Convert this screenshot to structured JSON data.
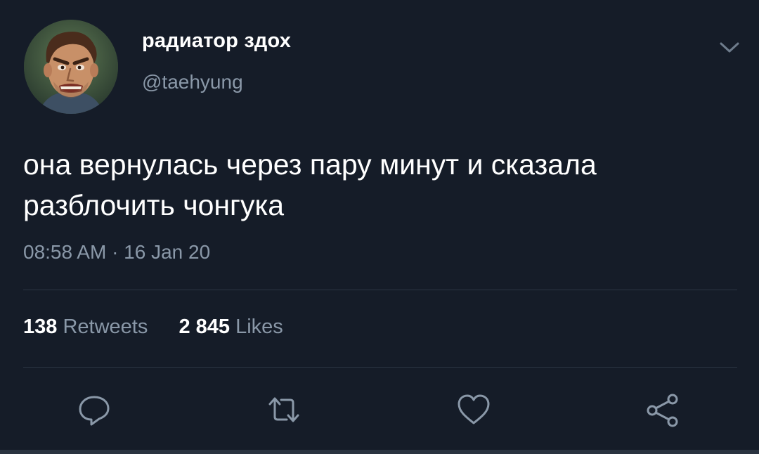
{
  "tweet": {
    "author": {
      "display_name": "радиатор здох",
      "handle": "@taehyung",
      "avatar_icon": "avatar-cartoon-man"
    },
    "text_line1": "она вернулась через пару минут и сказала",
    "text_line2": "разблочить чонгука",
    "timestamp": "08:58 AM · 16 Jan 20",
    "stats": {
      "retweets_count": "138",
      "retweets_label": "Retweets",
      "likes_count": "2 845",
      "likes_label": "Likes"
    },
    "actions": [
      {
        "name": "reply",
        "icon": "reply-icon"
      },
      {
        "name": "retweet",
        "icon": "retweet-icon"
      },
      {
        "name": "like",
        "icon": "heart-icon"
      },
      {
        "name": "share",
        "icon": "share-icon"
      }
    ],
    "menu_icon": "chevron-down-icon"
  },
  "colors": {
    "background": "#151c28",
    "primary_text": "#ffffff",
    "secondary_text": "#8a98a8",
    "divider": "#2c3644",
    "icon": "#8a98a8"
  }
}
